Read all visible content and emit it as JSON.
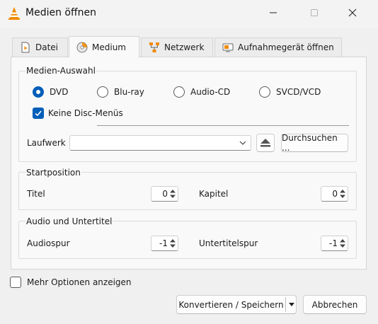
{
  "window": {
    "title": "Medien öffnen",
    "controls": {
      "minimize_icon": "minimize-icon",
      "maximize_icon": "maximize-icon",
      "close_icon": "close-icon"
    }
  },
  "tabs": [
    {
      "label": "Datei",
      "icon": "file-icon",
      "active": false
    },
    {
      "label": "Medium",
      "icon": "disc-icon",
      "active": true
    },
    {
      "label": "Netzwerk",
      "icon": "network-icon",
      "active": false
    },
    {
      "label": "Aufnahmegerät öffnen",
      "icon": "capture-device-icon",
      "active": false
    }
  ],
  "media_selection": {
    "title": "Medien-Auswahl",
    "options": [
      {
        "label": "DVD",
        "selected": true
      },
      {
        "label": "Blu-ray",
        "selected": false
      },
      {
        "label": "Audio-CD",
        "selected": false
      },
      {
        "label": "SVCD/VCD",
        "selected": false
      }
    ],
    "no_disc_menus": {
      "label": "Keine Disc-Menüs",
      "checked": true
    },
    "drive": {
      "label": "Laufwerk",
      "value": ""
    },
    "eject_icon": "eject-icon",
    "browse_label": "Durchsuchen ..."
  },
  "start_position": {
    "title": "Startposition",
    "title_label": "Titel",
    "title_value": "0",
    "chapter_label": "Kapitel",
    "chapter_value": "0"
  },
  "audio_subtitles": {
    "title": "Audio und Untertitel",
    "audio_label": "Audiospur",
    "audio_value": "-1",
    "subtitle_label": "Untertitelspur",
    "subtitle_value": "-1"
  },
  "more_options": {
    "label": "Mehr Optionen anzeigen",
    "checked": false
  },
  "actions": {
    "convert_save_label": "Konvertieren / Speichern",
    "cancel_label": "Abbrechen"
  },
  "colors": {
    "accent": "#005fb8",
    "vlc_orange": "#f08a00"
  }
}
